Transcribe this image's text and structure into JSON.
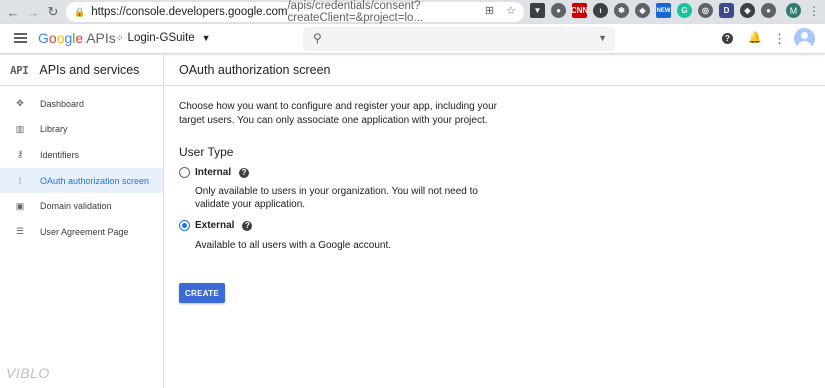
{
  "browser": {
    "url_host": "https://console.developers.google.com",
    "url_path": "/apis/credentials/consent?createClient=&project=lo..."
  },
  "header": {
    "brand_google": "Google",
    "brand_apis": "APIs",
    "project_name": "Login-GSuite",
    "search_placeholder": ""
  },
  "sidebar": {
    "logo": "API",
    "title": "APIs and services",
    "items": [
      {
        "label": "Dashboard",
        "icon": "dashboard-icon",
        "active": false
      },
      {
        "label": "Library",
        "icon": "library-icon",
        "active": false
      },
      {
        "label": "Identifiers",
        "icon": "key-icon",
        "active": false
      },
      {
        "label": "OAuth authorization screen",
        "icon": "consent-icon",
        "active": true
      },
      {
        "label": "Domain validation",
        "icon": "domain-icon",
        "active": false
      },
      {
        "label": "User Agreement Page",
        "icon": "settings-icon",
        "active": false
      }
    ],
    "watermark": "VIBLO"
  },
  "main": {
    "title": "OAuth authorization screen",
    "intro": "Choose how you want to configure and register your app, including your target users. You can only associate one application with your project.",
    "user_type_title": "User Type",
    "options": [
      {
        "label": "Internal",
        "description": "Only available to users in your organization. You will not need to validate your application.",
        "checked": false
      },
      {
        "label": "External",
        "description": "Available to all users with a Google account.",
        "checked": true
      }
    ],
    "create_label": "CREATE"
  },
  "colors": {
    "accent": "#1a73e8",
    "button": "#3b6bd6",
    "active_bg": "#e8f0fe"
  }
}
